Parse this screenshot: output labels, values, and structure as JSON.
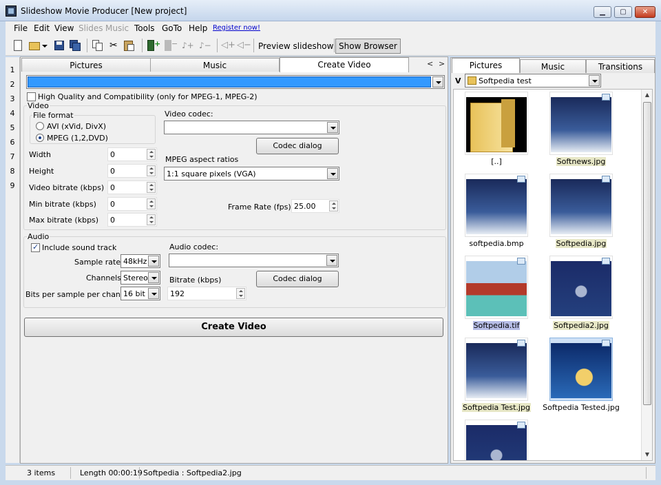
{
  "window": {
    "title": "Slideshow Movie Producer [New project]",
    "min_glyph": "▁",
    "max_glyph": "▢",
    "close_glyph": "✕"
  },
  "menu": {
    "file": "File",
    "edit": "Edit",
    "view": "View",
    "slides": "Slides",
    "music": "Music",
    "tools": "Tools",
    "goto": "GoTo",
    "help": "Help",
    "register": "Register now!"
  },
  "toolbar": {
    "preview": "Preview slideshow",
    "show_browser": "Show Browser"
  },
  "row_numbers": [
    "1",
    "2",
    "3",
    "4",
    "5",
    "6",
    "7",
    "8",
    "9"
  ],
  "left_tabs": {
    "pictures": "Pictures",
    "music": "Music",
    "create_video": "Create Video",
    "prev_arrow": "<",
    "next_arrow": ">"
  },
  "create_video": {
    "profile_select_value": "",
    "hq_label": "High Quality and Compatibility (only for MPEG-1, MPEG-2)",
    "video_group": "Video",
    "file_format_group": "File format",
    "format_avi": "AVI (xVid, DivX)",
    "format_mpeg": "MPEG (1,2,DVD)",
    "width_label": "Width",
    "width_value": "0",
    "height_label": "Height",
    "height_value": "0",
    "video_bitrate_label": "Video bitrate (kbps)",
    "video_bitrate_value": "0",
    "min_bitrate_label": "Min bitrate (kbps)",
    "min_bitrate_value": "0",
    "max_bitrate_label": "Max bitrate (kbps)",
    "max_bitrate_value": "0",
    "video_codec_label": "Video codec:",
    "video_codec_value": "",
    "codec_dialog": "Codec dialog",
    "aspect_label": "MPEG aspect ratios",
    "aspect_value": "1:1 square pixels (VGA)",
    "frame_rate_label": "Frame Rate (fps)",
    "frame_rate_value": "25.00",
    "audio_group": "Audio",
    "include_sound": "Include sound track",
    "sample_rate_label": "Sample rate:",
    "sample_rate_value": "48kHz",
    "channels_label": "Channels:",
    "channels_value": "Stereo",
    "bits_label": "Bits per sample per channel:",
    "bits_value": "16 bit",
    "audio_codec_label": "Audio codec:",
    "audio_codec_value": "",
    "audio_codec_dialog": "Codec dialog",
    "bitrate_label": "Bitrate (kbps)",
    "bitrate_value": "192",
    "create_button": "Create Video"
  },
  "right_tabs": {
    "pictures": "Pictures",
    "music": "Music",
    "transitions": "Transitions"
  },
  "browser": {
    "drive_letter": "V",
    "folder": "Softpedia test",
    "items": [
      {
        "name": "[..]",
        "style": "none"
      },
      {
        "name": "Softnews.jpg",
        "style": "hl"
      },
      {
        "name": "softpedia.bmp",
        "style": "none"
      },
      {
        "name": "Softpedia.jpg",
        "style": "hl"
      },
      {
        "name": "Softpedia.tif",
        "style": "sel"
      },
      {
        "name": "Softpedia2.jpg",
        "style": "hl"
      },
      {
        "name": "Softpedia Test.jpg",
        "style": "hl"
      },
      {
        "name": "Softpedia Tested.jpg",
        "style": "none"
      }
    ]
  },
  "status": {
    "items": "3 items",
    "length": "Length 00:00:19",
    "file": "Softpedia : Softpedia2.jpg"
  },
  "colors": {
    "accent": "#3399ff",
    "titlebar": "#c5d6ec"
  }
}
